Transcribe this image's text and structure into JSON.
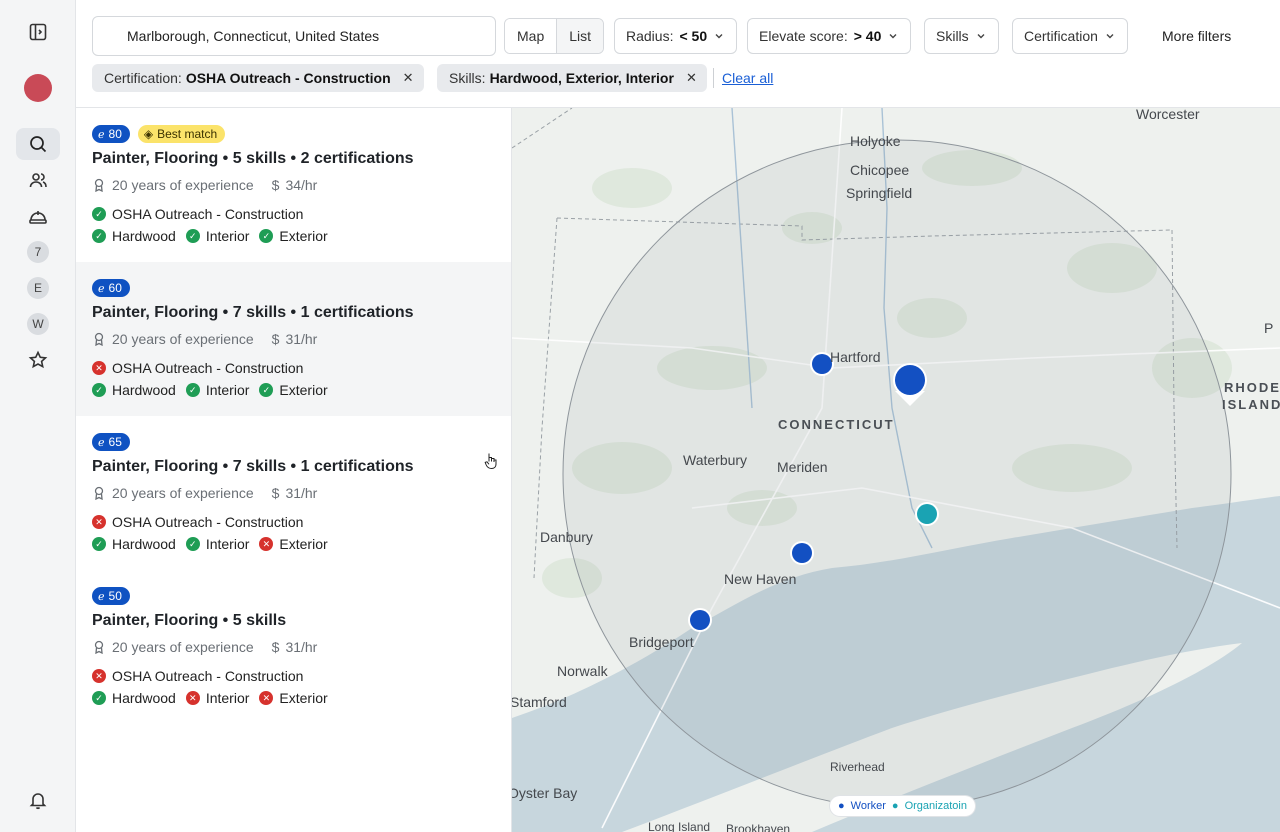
{
  "search": {
    "location": "Marlborough, Connecticut, United States"
  },
  "view_toggle": {
    "map": "Map",
    "list": "List"
  },
  "filters": {
    "radius_label": "Radius:",
    "radius_value": "< 50",
    "score_label": "Elevate score:",
    "score_value": "> 40",
    "skills": "Skills",
    "certification": "Certification",
    "more": "More filters"
  },
  "chips": [
    {
      "label": "Certification:",
      "value": "OSHA Outreach - Construction"
    },
    {
      "label": "Skills:",
      "value": "Hardwood, Exterior, Interior"
    }
  ],
  "clear_all": "Clear all",
  "rail": {
    "badges": [
      "7",
      "E",
      "W"
    ]
  },
  "results": [
    {
      "score": "80",
      "badge": "Best match",
      "title": "Painter, Flooring • 5 skills • 2 certifications",
      "experience": "20 years of experience",
      "rate": "34/hr",
      "cert": {
        "name": "OSHA Outreach - Construction",
        "ok": true
      },
      "skills": [
        {
          "name": "Hardwood",
          "ok": true
        },
        {
          "name": "Interior",
          "ok": true
        },
        {
          "name": "Exterior",
          "ok": true
        }
      ]
    },
    {
      "score": "60",
      "title": "Painter, Flooring • 7 skills • 1 certifications",
      "experience": "20 years of experience",
      "rate": "31/hr",
      "cert": {
        "name": "OSHA Outreach - Construction",
        "ok": false
      },
      "skills": [
        {
          "name": "Hardwood",
          "ok": true
        },
        {
          "name": "Interior",
          "ok": true
        },
        {
          "name": "Exterior",
          "ok": true
        }
      ]
    },
    {
      "score": "65",
      "title": "Painter, Flooring • 7 skills • 1 certifications",
      "experience": "20 years of experience",
      "rate": "31/hr",
      "cert": {
        "name": "OSHA Outreach - Construction",
        "ok": false
      },
      "skills": [
        {
          "name": "Hardwood",
          "ok": true
        },
        {
          "name": "Interior",
          "ok": true
        },
        {
          "name": "Exterior",
          "ok": false
        }
      ]
    },
    {
      "score": "50",
      "title": "Painter, Flooring • 5 skills",
      "experience": "20 years of experience",
      "rate": "31/hr",
      "cert": {
        "name": "OSHA Outreach - Construction",
        "ok": false
      },
      "skills": [
        {
          "name": "Hardwood",
          "ok": true
        },
        {
          "name": "Interior",
          "ok": false
        },
        {
          "name": "Exterior",
          "ok": false
        }
      ]
    }
  ],
  "map": {
    "places": {
      "worcester": "Worcester",
      "holyoke": "Holyoke",
      "chicopee": "Chicopee",
      "springfield": "Springfield",
      "hartford": "Hartford",
      "waterbury": "Waterbury",
      "meriden": "Meriden",
      "danbury": "Danbury",
      "new_haven": "New Haven",
      "bridgeport": "Bridgeport",
      "norwalk": "Norwalk",
      "stamford": "Stamford",
      "riverhead": "Riverhead",
      "oyster_bay": "Oyster Bay",
      "long_island": "Long Island",
      "brookhaven": "Brookhaven",
      "p": "P"
    },
    "state_label": "CONNECTICUT",
    "rhode_island_1": "RHODE",
    "rhode_island_2": "ISLAND",
    "legend": {
      "worker": "Worker",
      "org": "Organizatoin"
    },
    "colors": {
      "worker": "#1350c2",
      "org": "#1aa3b3"
    }
  }
}
